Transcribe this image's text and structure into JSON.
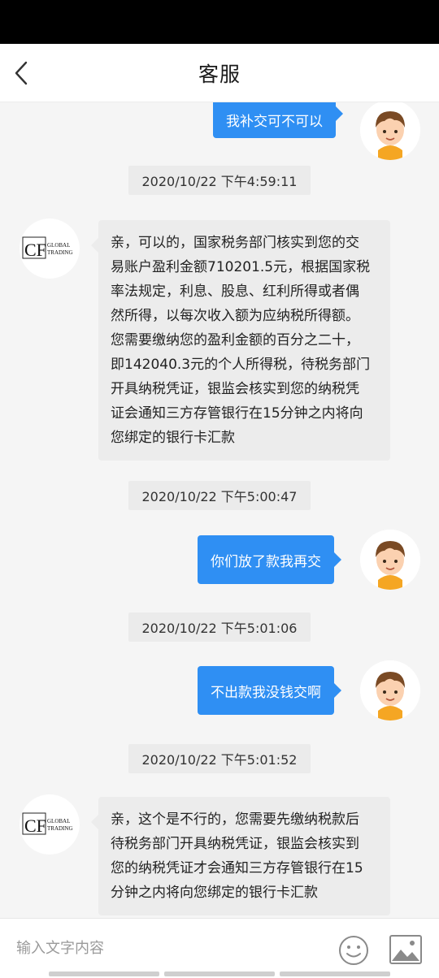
{
  "header": {
    "title": "客服",
    "back_icon": "chevron-left-icon"
  },
  "colors": {
    "outgoing_bubble": "#2f8ff3",
    "incoming_bubble": "#ececec",
    "timestamp_bg": "#ebebeb"
  },
  "agent": {
    "logo_letters": "CF",
    "logo_line1": "GLOBAL",
    "logo_line2": "TRADING"
  },
  "messages": [
    {
      "type": "out",
      "text": "我补交可不可以"
    },
    {
      "type": "time",
      "text": "2020/10/22 下午4:59:11"
    },
    {
      "type": "in",
      "lines": [
        "亲，可以的，国家税务部门核实到您的交",
        "易账户盈利金额710201.5元，根据国家税",
        "率法规定，利息、股息、红利所得或者偶",
        "然所得，以每次收入额为应纳税所得额。",
        "您需要缴纳您的盈利金额的百分之二十，",
        "即142040.3元的个人所得税，待税务部门",
        "开具纳税凭证，银监会核实到您的纳税凭",
        "证会通知三方存管银行在15分钟之内将向",
        "您绑定的银行卡汇款"
      ]
    },
    {
      "type": "time",
      "text": "2020/10/22 下午5:00:47"
    },
    {
      "type": "out",
      "text": "你们放了款我再交"
    },
    {
      "type": "time",
      "text": "2020/10/22 下午5:01:06"
    },
    {
      "type": "out",
      "text": "不出款我没钱交啊"
    },
    {
      "type": "time",
      "text": "2020/10/22 下午5:01:52"
    },
    {
      "type": "in",
      "lines": [
        "亲，这个是不行的，您需要先缴纳税款后",
        "待税务部门开具纳税凭证，银监会核实到",
        "您的纳税凭证才会通知三方存管银行在15",
        "分钟之内将向您绑定的银行卡汇款"
      ]
    }
  ],
  "input": {
    "placeholder": "输入文字内容",
    "value": ""
  },
  "icons": {
    "emoji": "smiley-icon",
    "image": "image-icon"
  }
}
